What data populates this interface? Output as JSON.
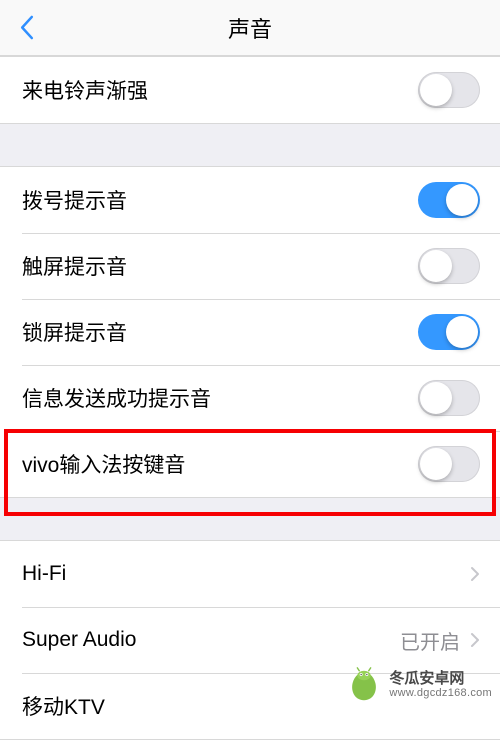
{
  "header": {
    "title": "声音"
  },
  "section1": {
    "items": [
      {
        "label": "来电铃声渐强",
        "on": false
      }
    ]
  },
  "section2": {
    "items": [
      {
        "label": "拨号提示音",
        "on": true
      },
      {
        "label": "触屏提示音",
        "on": false
      },
      {
        "label": "锁屏提示音",
        "on": true
      },
      {
        "label": "信息发送成功提示音",
        "on": false
      },
      {
        "label": "vivo输入法按键音",
        "on": false
      }
    ]
  },
  "section3": {
    "items": [
      {
        "label": "Hi-Fi",
        "value": ""
      },
      {
        "label": "Super Audio",
        "value": "已开启"
      },
      {
        "label": "移动KTV",
        "value": ""
      }
    ]
  },
  "watermark": {
    "name": "冬瓜安卓网",
    "url": "www.dgcdz168.com"
  }
}
